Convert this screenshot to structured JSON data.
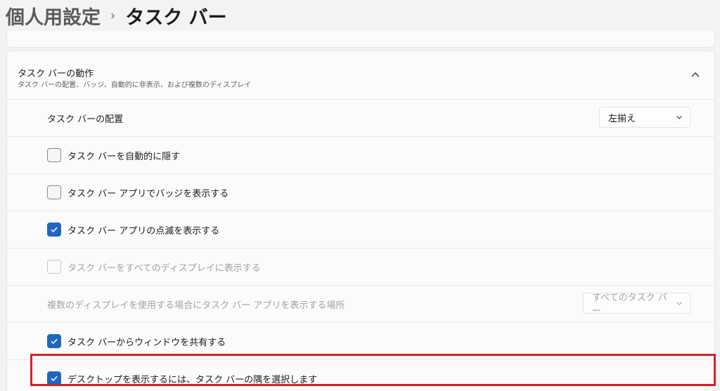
{
  "breadcrumb": {
    "parent": "個人用設定",
    "separator": "›",
    "current": "タスク バー"
  },
  "section": {
    "title": "タスク バーの動作",
    "subtitle": "タスク バーの配置、バッジ、自動的に非表示、および複数のディスプレイ",
    "expanded": true
  },
  "rows": {
    "alignment": {
      "label": "タスク バーの配置",
      "value": "左揃え"
    },
    "auto_hide": {
      "label": "タスク バーを自動的に隠す",
      "checked": false
    },
    "badges": {
      "label": "タスク バー アプリでバッジを表示する",
      "checked": false
    },
    "flashing": {
      "label": "タスク バー アプリの点滅を表示する",
      "checked": true
    },
    "all_displays": {
      "label": "タスク バーをすべてのディスプレイに表示する",
      "checked": false,
      "disabled": true
    },
    "multi_display": {
      "label": "複数のディスプレイを使用する場合にタスク バー アプリを表示する場所",
      "value": "すべてのタスク バー",
      "disabled": true
    },
    "share_window": {
      "label": "タスク バーからウィンドウを共有する",
      "checked": true
    },
    "corner_desktop": {
      "label": "デスクトップを表示するには、タスク バーの隅を選択します",
      "checked": true
    }
  },
  "colors": {
    "accent": "#1f66c4",
    "highlight": "#d6202a"
  }
}
